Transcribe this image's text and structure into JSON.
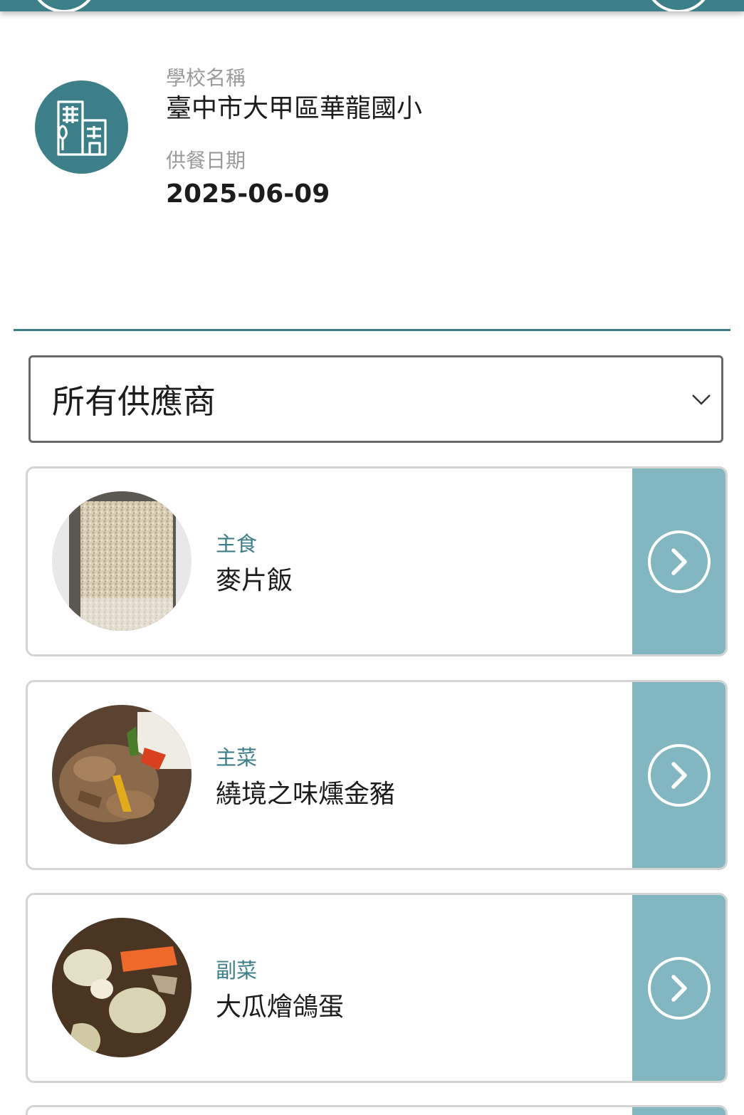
{
  "school": {
    "name_label": "學校名稱",
    "name": "臺中市大甲區華龍國小",
    "date_label": "供餐日期",
    "date": "2025-06-09",
    "icon": "building-icon"
  },
  "supplier_select": {
    "selected": "所有供應商"
  },
  "dishes": [
    {
      "category": "主食",
      "name": "麥片飯",
      "image": "oat-rice-photo"
    },
    {
      "category": "主菜",
      "name": "繞境之味燻金豬",
      "image": "smoked-pork-photo"
    },
    {
      "category": "副菜",
      "name": "大瓜燴鴿蛋",
      "image": "melon-quail-egg-photo"
    }
  ],
  "colors": {
    "brand": "#3d7f88",
    "card_action": "#82b6c0"
  }
}
